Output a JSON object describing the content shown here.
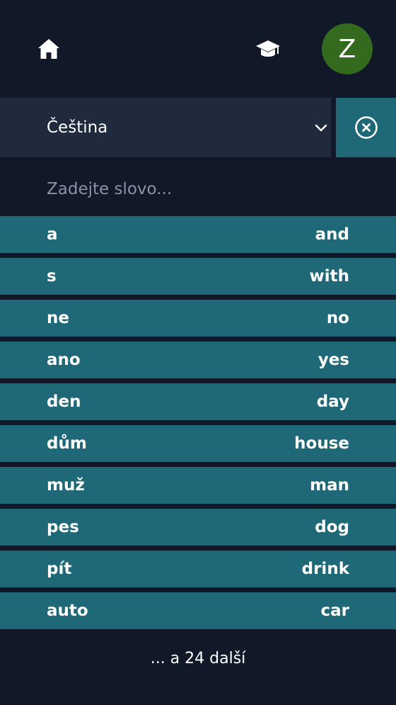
{
  "header": {
    "home_icon": "home-icon",
    "learn_icon": "graduation-cap-icon",
    "avatar_letter": "Z",
    "avatar_color": "#336a1e"
  },
  "language_select": {
    "selected": "Čeština",
    "chevron_icon": "chevron-down-icon"
  },
  "clear_button": {
    "icon": "circle-x-icon"
  },
  "search": {
    "placeholder": "Zadejte slovo...",
    "value": ""
  },
  "words": [
    {
      "source": "a",
      "target": "and"
    },
    {
      "source": "s",
      "target": "with"
    },
    {
      "source": "ne",
      "target": "no"
    },
    {
      "source": "ano",
      "target": "yes"
    },
    {
      "source": "den",
      "target": "day"
    },
    {
      "source": "dům",
      "target": "house"
    },
    {
      "source": "muž",
      "target": "man"
    },
    {
      "source": "pes",
      "target": "dog"
    },
    {
      "source": "pít",
      "target": "drink"
    },
    {
      "source": "auto",
      "target": "car"
    }
  ],
  "more_label": "... a 24 další",
  "colors": {
    "background": "#111827",
    "select_bg": "#1f2a3c",
    "accent": "#1e6877"
  }
}
